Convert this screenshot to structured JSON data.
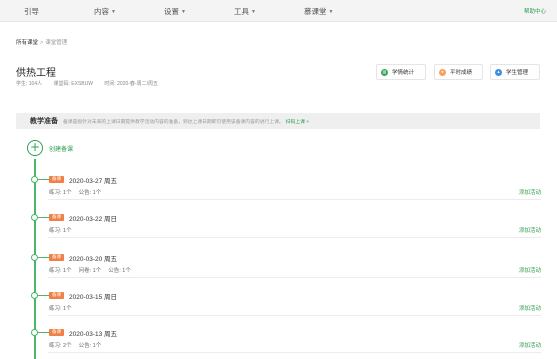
{
  "nav": {
    "items": [
      {
        "label": "引导",
        "caret": false
      },
      {
        "label": "内容",
        "caret": true
      },
      {
        "label": "设置",
        "caret": true
      },
      {
        "label": "工具",
        "caret": true
      },
      {
        "label": "慕课堂",
        "caret": true
      }
    ],
    "help": "帮助中心"
  },
  "breadcrumb": {
    "root": "所有课堂",
    "sep": ">",
    "current": "课堂管理"
  },
  "course": {
    "title": "供热工程",
    "students": "学生: 104人",
    "code": "课堂码: EXSBUW",
    "time": "时间: 2020-春-周二/周五"
  },
  "buttons": [
    {
      "label": "学情统计",
      "icon": "chart-icon",
      "color": "#3aa657"
    },
    {
      "label": "平时成绩",
      "icon": "score-icon",
      "color": "#f5a35b"
    },
    {
      "label": "学生管理",
      "icon": "user-icon",
      "color": "#3b8fe0"
    }
  ],
  "prep": {
    "title": "教学准备",
    "desc": "备课是指针对未来的上课日期提供教学活动内容的准备，到达上课日期即可使用该备课内容的进行上课。",
    "link": "扫码上课 >"
  },
  "create_label": "创建备课",
  "entries": [
    {
      "badge": "备课",
      "date": "2020-03-27 周五",
      "stats": [
        "练习: 1个",
        "公告: 1个"
      ],
      "add": "添加活动"
    },
    {
      "badge": "备课",
      "date": "2020-03-22 周日",
      "stats": [
        "练习: 1个"
      ],
      "add": "添加活动"
    },
    {
      "badge": "备课",
      "date": "2020-03-20 周五",
      "stats": [
        "练习: 1个",
        "问卷: 1个",
        "公告: 1个"
      ],
      "add": "添加活动"
    },
    {
      "badge": "备课",
      "date": "2020-03-15 周日",
      "stats": [
        "练习: 1个"
      ],
      "add": "添加活动"
    },
    {
      "badge": "备课",
      "date": "2020-03-13 周五",
      "stats": [
        "练习: 2个",
        "公告: 1个"
      ],
      "add": "添加活动"
    }
  ]
}
